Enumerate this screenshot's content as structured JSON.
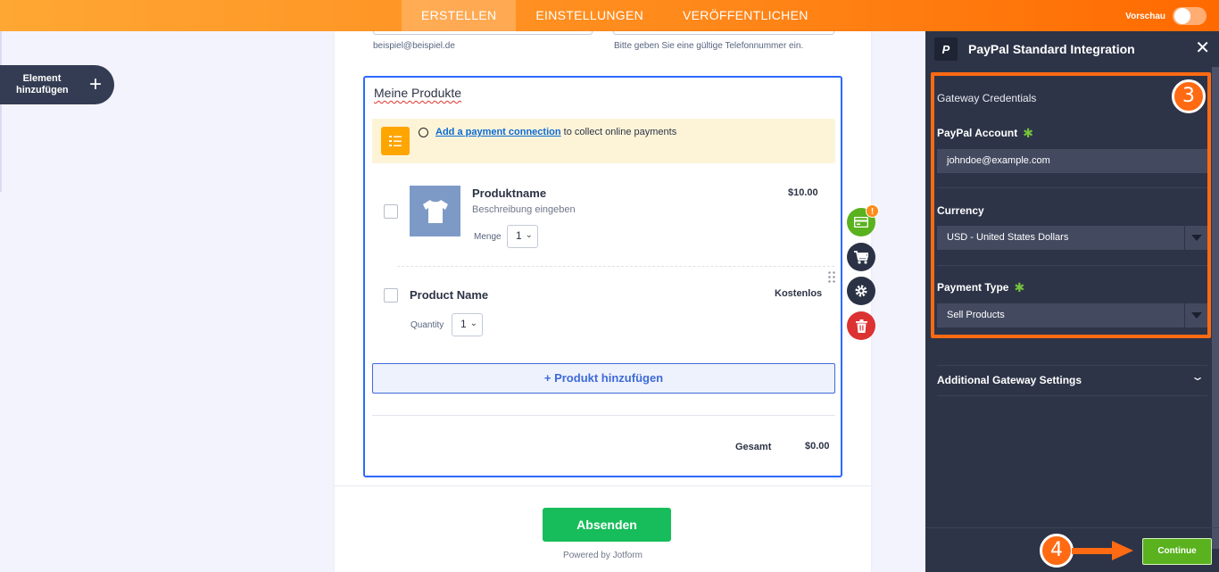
{
  "topbar": {
    "tabs": [
      {
        "label": "ERSTELLEN",
        "active": true
      },
      {
        "label": "EINSTELLUNGEN",
        "active": false
      },
      {
        "label": "VERÖFFENTLICHEN",
        "active": false
      }
    ],
    "preview_label": "Vorschau",
    "preview_on": false
  },
  "left": {
    "add_element_label": "Element hinzufügen",
    "add_icon": "plus-icon"
  },
  "form": {
    "email_hint": "beispiel@beispiel.de",
    "phone_hint": "Bitte geben Sie eine gültige Telefonnummer ein.",
    "products_title": "Meine Produkte",
    "notice": {
      "link": "Add a payment connection",
      "text": "to collect online payments"
    },
    "products": [
      {
        "name": "Produktname",
        "description": "Beschreibung eingeben",
        "qty_label": "Menge",
        "qty": "1",
        "price": "$10.00"
      },
      {
        "name": "Product Name",
        "qty_label": "Quantity",
        "qty": "1",
        "price": "Kostenlos"
      }
    ],
    "add_product": "+ Produkt hinzufügen",
    "total_label": "Gesamt",
    "total_value": "$0.00",
    "submit": "Absenden",
    "powered_by": "Powered by Jotform"
  },
  "tools": {
    "badge": "!",
    "icons": [
      "payment-icon",
      "cart-icon",
      "gear-icon",
      "trash-icon"
    ]
  },
  "panel": {
    "logo": "P",
    "title": "PayPal Standard Integration",
    "close": "✕",
    "section_title": "Gateway Credentials",
    "account_label": "PayPal Account",
    "account_value": "johndoe@example.com",
    "currency_label": "Currency",
    "currency_value": "USD - United States Dollars",
    "payment_type_label": "Payment Type",
    "payment_type_value": "Sell Products",
    "additional_settings": "Additional Gateway Settings",
    "continue": "Continue"
  },
  "annotations": {
    "step3": "3",
    "step4": "4",
    "color": "#ff6a13"
  },
  "colors": {
    "brand_orange": "#ff8a1c",
    "panel_bg": "#2d3447",
    "green": "#5ab21e",
    "submit_green": "#18bd5b",
    "link_blue": "#0b6ad6",
    "danger": "#dc3232"
  }
}
